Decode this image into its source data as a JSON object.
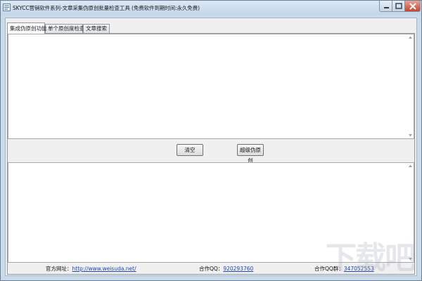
{
  "window": {
    "title": "SKYCC营销软件系列-文章采集伪原创批量检查工具 (免费软件到期时间:永久免费)"
  },
  "tabs": [
    {
      "label": "集成伪原创功能",
      "active": true
    },
    {
      "label": "单个原创度检查",
      "active": false
    },
    {
      "label": "文章搜索",
      "active": false
    }
  ],
  "buttons": {
    "clear": "清空",
    "pseudo_original": "超级伪原创"
  },
  "footer": {
    "site_label": "官方网址：",
    "site_url": "http://www.weisuda.net/",
    "qq_label": "合作QQ：",
    "qq_value": "920293760",
    "group_label": "合作QQ群：",
    "group_value": "347052553"
  },
  "watermark": "下载吧",
  "colors": {
    "frame": "#c9daea",
    "client": "#f0f0f0",
    "link": "#1b46b5",
    "close_button": "#c7432d"
  }
}
